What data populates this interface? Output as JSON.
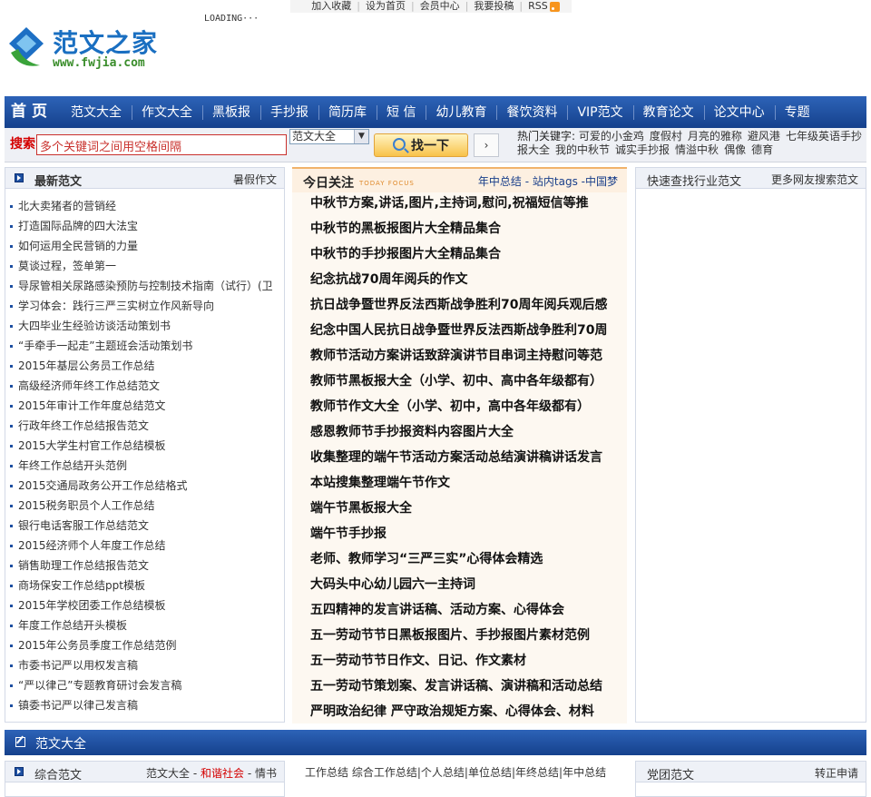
{
  "top_links": [
    "加入收藏",
    "设为首页",
    "会员中心",
    "我要投稿",
    "RSS"
  ],
  "loading_text": "LOADING···",
  "logo": {
    "title": "范文之家",
    "url": "www.fwjia.com"
  },
  "nav": {
    "home": "首 页",
    "items": [
      "范文大全",
      "作文大全",
      "黑板报",
      "手抄报",
      "简历库",
      "短 信",
      "幼儿教育",
      "餐饮资料",
      "VIP范文",
      "教育论文",
      "论文中心",
      "专题"
    ]
  },
  "search": {
    "label": "搜索",
    "placeholder": "多个关键词之间用空格间隔",
    "category": "范文大全",
    "button": "找一下",
    "more_button": "›",
    "hot_label": "热门关键字:",
    "hot_keywords": [
      "可爱的小金鸡",
      "度假村",
      "月亮的雅称",
      "避风港",
      "七年级英语手抄报大全",
      "我的中秋节",
      "诚实手抄报",
      "情溢中秋",
      "偶像",
      "德育"
    ]
  },
  "left_panel": {
    "title": "最新范文",
    "more": "暑假作文",
    "items": [
      "北大卖猪者的营销经",
      "打造国际品牌的四大法宝",
      "如何运用全民营销的力量",
      "莫谈过程，签单第一",
      "导尿管相关尿路感染预防与控制技术指南（试行）(卫",
      "学习体会：践行三严三实树立作风新导向",
      "大四毕业生经验访谈活动策划书",
      "“手牵手一起走”主题班会活动策划书",
      "2015年基层公务员工作总结",
      "高级经济师年终工作总结范文",
      "2015年审计工作年度总结范文",
      "行政年终工作总结报告范文",
      "2015大学生村官工作总结模板",
      "年终工作总结开头范例",
      "2015交通局政务公开工作总结格式",
      "2015税务职员个人工作总结",
      "银行电话客服工作总结范文",
      "2015经济师个人年度工作总结",
      "销售助理工作总结报告范文",
      "商场保安工作总结ppt模板",
      "2015年学校团委工作总结模板",
      "年度工作总结开头模板",
      "2015年公务员季度工作总结范例",
      "市委书记严以用权发言稿",
      "“严以律己”专题教育研讨会发言稿",
      "镇委书记严以律己发言稿"
    ]
  },
  "focus_panel": {
    "title": "今日关注",
    "subtitle_en": "TODAY FOCUS",
    "links": [
      "年中总结",
      "站内tags",
      "中国梦"
    ],
    "items": [
      "中秋节方案,讲话,图片,主持词,慰问,祝福短信等推",
      "中秋节的黑板报图片大全精品集合",
      "中秋节的手抄报图片大全精品集合",
      "纪念抗战70周年阅兵的作文",
      "抗日战争暨世界反法西斯战争胜利70周年阅兵观后感",
      "纪念中国人民抗日战争暨世界反法西斯战争胜利70周",
      "教师节活动方案讲话致辞演讲节目串词主持慰问等范",
      "教师节黑板报大全（小学、初中、高中各年级都有）",
      "教师节作文大全（小学、初中，高中各年级都有）",
      "感恩教师节手抄报资料内容图片大全",
      "收集整理的端午节活动方案活动总结演讲稿讲话发言",
      "本站搜集整理端午节作文",
      "端午节黑板报大全",
      "端午节手抄报",
      "老师、教师学习“三严三实”心得体会精选",
      "大码头中心幼儿园六一主持词",
      "五四精神的发言讲话稿、活动方案、心得体会",
      "五一劳动节节日黑板报图片、手抄报图片素材范例",
      "五一劳动节节日作文、日记、作文素材",
      "五一劳动节策划案、发言讲话稿、演讲稿和活动总结",
      "严明政治纪律 严守政治规矩方案、心得体会、材料"
    ]
  },
  "right_panel": {
    "title": "快速查找行业范文",
    "more": "更多网友搜索范文"
  },
  "section": {
    "title": "范文大全"
  },
  "bottom": {
    "col1": {
      "title": "综合范文",
      "links": [
        "范文大全",
        "和谐社会",
        "情书"
      ]
    },
    "col2": {
      "links": [
        "工作总结",
        "综合工作总结",
        "个人总结",
        "单位总结",
        "年终总结",
        "年中总结"
      ]
    },
    "col3": {
      "title": "党团范文",
      "more": "转正申请"
    }
  },
  "colors": {
    "nav_blue": "#1b4a9a",
    "accent_red": "#d40000",
    "focus_bg": "#fdf8f1"
  }
}
